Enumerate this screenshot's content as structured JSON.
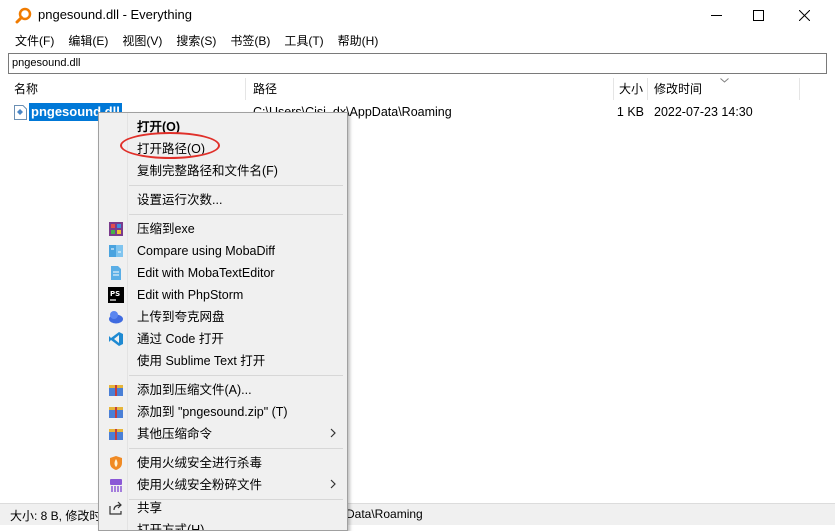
{
  "window": {
    "title": "pngesound.dll - Everything"
  },
  "menu": [
    "文件(F)",
    "编辑(E)",
    "视图(V)",
    "搜索(S)",
    "书签(B)",
    "工具(T)",
    "帮助(H)"
  ],
  "search": {
    "value": "pngesound.dll"
  },
  "columns": {
    "name": "名称",
    "path": "路径",
    "size": "大小",
    "date": "修改时间"
  },
  "rows": [
    {
      "name": "pngesound.dll",
      "path": "C:\\Users\\Cisi_dx\\AppData\\Roaming",
      "size": "1 KB",
      "date": "2022-07-23 14:30"
    }
  ],
  "status": {
    "left": "大小: 8 B, 修改时",
    "mid": "Data\\Roaming"
  },
  "context_menu": {
    "open": "打开(O)",
    "open_path": "打开路径(O)",
    "copy_full_path": "复制完整路径和文件名(F)",
    "set_run_count": "设置运行次数...",
    "compress_exe": "压缩到exe",
    "mobadiff": "Compare using MobaDiff",
    "mobatext": "Edit with MobaTextEditor",
    "phpstorm": "Edit with PhpStorm",
    "quark": "上传到夸克网盘",
    "vscode": "通过 Code 打开",
    "sublime": "使用 Sublime Text 打开",
    "add_archive": "添加到压缩文件(A)...",
    "add_zip": "添加到 \"pngesound.zip\" (T)",
    "other_compress": "其他压缩命令",
    "huorong_scan": "使用火绒安全进行杀毒",
    "huorong_shred": "使用火绒安全粉碎文件",
    "share": "共享",
    "open_with": "打开方式(H)"
  },
  "colors": {
    "selection": "#0078d7",
    "annotation": "#e0302a"
  }
}
